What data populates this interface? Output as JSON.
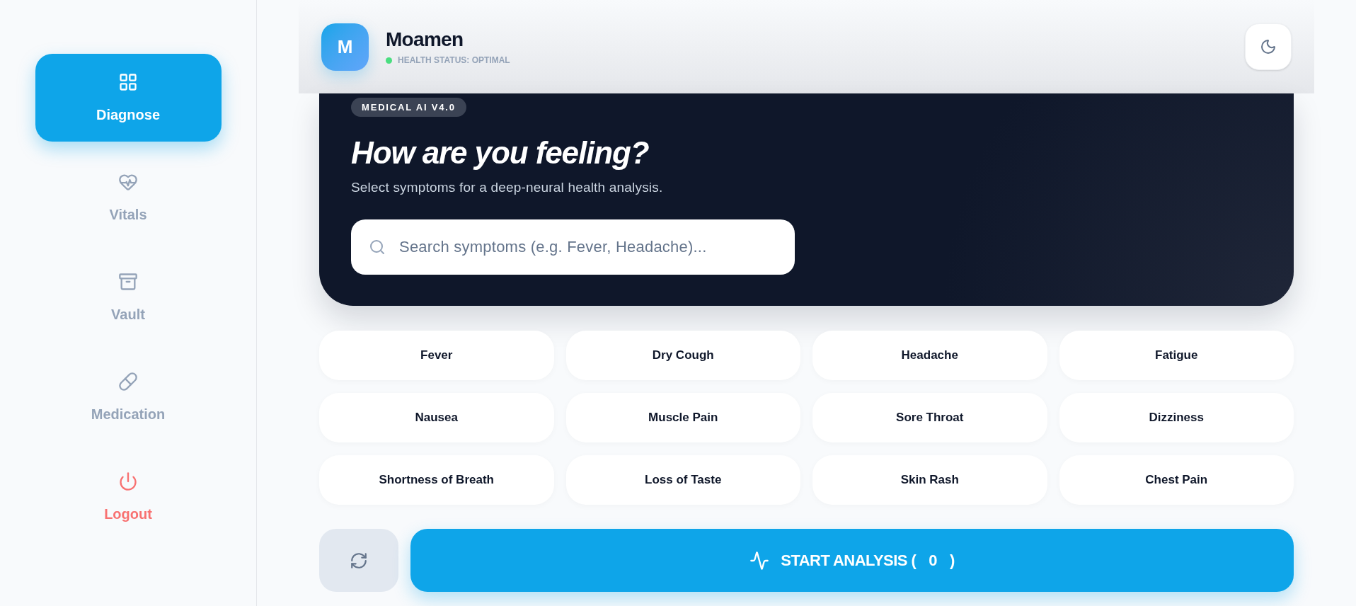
{
  "sidebar": {
    "items": [
      {
        "label": "Diagnose",
        "selected": true
      },
      {
        "label": "Vitals",
        "selected": false
      },
      {
        "label": "Vault",
        "selected": false
      },
      {
        "label": "Medication",
        "selected": false
      }
    ],
    "logout": {
      "label": "Logout"
    }
  },
  "header": {
    "avatar_initial": "M",
    "user_name": "Moamen",
    "status": "HEALTH STATUS: OPTIMAL"
  },
  "hero": {
    "badge": "MEDICAL AI V4.0",
    "title": "How are you feeling?",
    "subtitle": "Select symptoms for a deep-neural health analysis.",
    "search": {
      "placeholder": "Search symptoms (e.g. Fever, Headache)..."
    }
  },
  "symptoms": [
    {
      "label": "Fever",
      "selected": false
    },
    {
      "label": "Dry Cough",
      "selected": false
    },
    {
      "label": "Headache",
      "selected": false
    },
    {
      "label": "Fatigue",
      "selected": false
    },
    {
      "label": "Nausea",
      "selected": false
    },
    {
      "label": "Muscle Pain",
      "selected": false
    },
    {
      "label": "Sore Throat",
      "selected": false
    },
    {
      "label": "Dizziness",
      "selected": false
    },
    {
      "label": "Shortness of Breath",
      "selected": false
    },
    {
      "label": "Loss of Taste",
      "selected": false
    },
    {
      "label": "Skin Rash",
      "selected": false
    },
    {
      "label": "Chest Pain",
      "selected": false
    }
  ],
  "actions": {
    "start_button": {
      "label": "START ANALYSIS (",
      "count": "0",
      "closing": ")"
    }
  }
}
